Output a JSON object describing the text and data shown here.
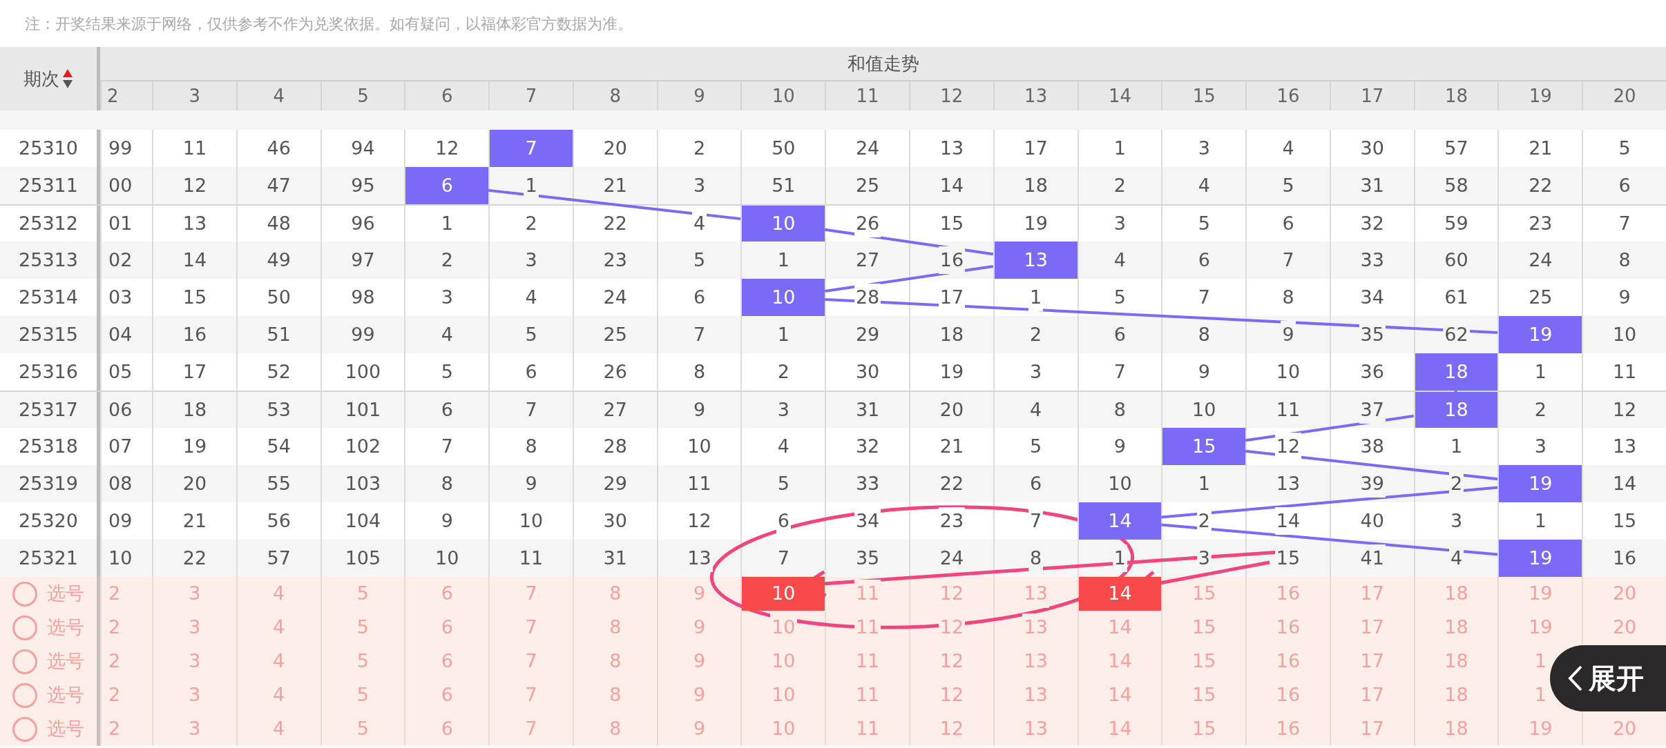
{
  "notice": "注：开奖结果来源于网络，仅供参考不作为兑奖依据。如有疑问，以福体彩官方数据为准。",
  "table": {
    "period_header": "期次",
    "sort_ascending": true,
    "group_header": "和值走势",
    "columns": [
      "2",
      "3",
      "4",
      "5",
      "6",
      "7",
      "8",
      "9",
      "10",
      "11",
      "12",
      "13",
      "14",
      "15",
      "16",
      "17",
      "18",
      "19",
      "20"
    ],
    "rows": [
      {
        "period": "25310",
        "cells": [
          "99",
          "11",
          "46",
          "94",
          "12",
          {
            "text": "7",
            "hit": true
          },
          "20",
          "2",
          "50",
          "24",
          "13",
          "17",
          "1",
          "3",
          "4",
          "30",
          "57",
          "21",
          "5"
        ]
      },
      {
        "period": "25311",
        "cells": [
          "00",
          "12",
          "47",
          "95",
          {
            "text": "6",
            "hit": true
          },
          "1",
          "21",
          "3",
          "51",
          "25",
          "14",
          "18",
          "2",
          "4",
          "5",
          "31",
          "58",
          "22",
          "6"
        ]
      },
      {
        "period": "25312",
        "cells": [
          "01",
          "13",
          "48",
          "96",
          "1",
          "2",
          "22",
          "4",
          {
            "text": "10",
            "hit": true
          },
          "26",
          "15",
          "19",
          "3",
          "5",
          "6",
          "32",
          "59",
          "23",
          "7"
        ]
      },
      {
        "period": "25313",
        "cells": [
          "02",
          "14",
          "49",
          "97",
          "2",
          "3",
          "23",
          "5",
          "1",
          "27",
          "16",
          {
            "text": "13",
            "hit": true
          },
          "4",
          "6",
          "7",
          "33",
          "60",
          "24",
          "8"
        ]
      },
      {
        "period": "25314",
        "cells": [
          "03",
          "15",
          "50",
          "98",
          "3",
          "4",
          "24",
          "6",
          {
            "text": "10",
            "hit": true
          },
          "28",
          "17",
          "1",
          "5",
          "7",
          "8",
          "34",
          "61",
          "25",
          "9"
        ]
      },
      {
        "period": "25315",
        "cells": [
          "04",
          "16",
          "51",
          "99",
          "4",
          "5",
          "25",
          "7",
          "1",
          "29",
          "18",
          "2",
          "6",
          "8",
          "9",
          "35",
          "62",
          {
            "text": "19",
            "hit": true
          },
          "10"
        ]
      },
      {
        "period": "25316",
        "cells": [
          "05",
          "17",
          "52",
          "100",
          "5",
          "6",
          "26",
          "8",
          "2",
          "30",
          "19",
          "3",
          "7",
          "9",
          "10",
          "36",
          {
            "text": "18",
            "hit": true
          },
          "1",
          "11"
        ]
      },
      {
        "period": "25317",
        "cells": [
          "06",
          "18",
          "53",
          "101",
          "6",
          "7",
          "27",
          "9",
          "3",
          "31",
          "20",
          "4",
          "8",
          "10",
          "11",
          "37",
          {
            "text": "18",
            "hit": true
          },
          "2",
          "12"
        ]
      },
      {
        "period": "25318",
        "cells": [
          "07",
          "19",
          "54",
          "102",
          "7",
          "8",
          "28",
          "10",
          "4",
          "32",
          "21",
          "5",
          "9",
          {
            "text": "15",
            "hit": true
          },
          "12",
          "38",
          "1",
          "3",
          "13"
        ]
      },
      {
        "period": "25319",
        "cells": [
          "08",
          "20",
          "55",
          "103",
          "8",
          "9",
          "29",
          "11",
          "5",
          "33",
          "22",
          "6",
          "10",
          "1",
          "13",
          "39",
          "2",
          {
            "text": "19",
            "hit": true
          },
          "14"
        ]
      },
      {
        "period": "25320",
        "cells": [
          "09",
          "21",
          "56",
          "104",
          "9",
          "10",
          "30",
          "12",
          "6",
          "34",
          "23",
          "7",
          {
            "text": "14",
            "hit": true
          },
          "2",
          "14",
          "40",
          "3",
          "1",
          "15"
        ]
      },
      {
        "period": "25321",
        "cells": [
          "10",
          "22",
          "57",
          "105",
          "10",
          "11",
          "31",
          "13",
          "7",
          "35",
          "24",
          "8",
          "1",
          "3",
          "15",
          "41",
          "4",
          {
            "text": "19",
            "hit": true
          },
          "16"
        ]
      }
    ],
    "pick_rows": [
      {
        "label": "选号",
        "checked": false,
        "cells": [
          {
            "text": "2",
            "selected": false
          },
          {
            "text": "3",
            "selected": false
          },
          {
            "text": "4",
            "selected": false
          },
          {
            "text": "5",
            "selected": false
          },
          {
            "text": "6",
            "selected": false
          },
          {
            "text": "7",
            "selected": false
          },
          {
            "text": "8",
            "selected": false
          },
          {
            "text": "9",
            "selected": false
          },
          {
            "text": "10",
            "selected": true
          },
          {
            "text": "11",
            "selected": false
          },
          {
            "text": "12",
            "selected": false
          },
          {
            "text": "13",
            "selected": false
          },
          {
            "text": "14",
            "selected": true
          },
          {
            "text": "15",
            "selected": false
          },
          {
            "text": "16",
            "selected": false
          },
          {
            "text": "17",
            "selected": false
          },
          {
            "text": "18",
            "selected": false
          },
          {
            "text": "19",
            "selected": false
          },
          {
            "text": "20",
            "selected": false
          }
        ]
      },
      {
        "label": "选号",
        "checked": false,
        "cells": [
          {
            "text": "2",
            "selected": false
          },
          {
            "text": "3",
            "selected": false
          },
          {
            "text": "4",
            "selected": false
          },
          {
            "text": "5",
            "selected": false
          },
          {
            "text": "6",
            "selected": false
          },
          {
            "text": "7",
            "selected": false
          },
          {
            "text": "8",
            "selected": false
          },
          {
            "text": "9",
            "selected": false
          },
          {
            "text": "10",
            "selected": false
          },
          {
            "text": "11",
            "selected": false
          },
          {
            "text": "12",
            "selected": false
          },
          {
            "text": "13",
            "selected": false
          },
          {
            "text": "14",
            "selected": false
          },
          {
            "text": "15",
            "selected": false
          },
          {
            "text": "16",
            "selected": false
          },
          {
            "text": "17",
            "selected": false
          },
          {
            "text": "18",
            "selected": false
          },
          {
            "text": "19",
            "selected": false
          },
          {
            "text": "20",
            "selected": false
          }
        ]
      },
      {
        "label": "选号",
        "checked": false,
        "cells": [
          {
            "text": "2",
            "selected": false
          },
          {
            "text": "3",
            "selected": false
          },
          {
            "text": "4",
            "selected": false
          },
          {
            "text": "5",
            "selected": false
          },
          {
            "text": "6",
            "selected": false
          },
          {
            "text": "7",
            "selected": false
          },
          {
            "text": "8",
            "selected": false
          },
          {
            "text": "9",
            "selected": false
          },
          {
            "text": "10",
            "selected": false
          },
          {
            "text": "11",
            "selected": false
          },
          {
            "text": "12",
            "selected": false
          },
          {
            "text": "13",
            "selected": false
          },
          {
            "text": "14",
            "selected": false
          },
          {
            "text": "15",
            "selected": false
          },
          {
            "text": "16",
            "selected": false
          },
          {
            "text": "17",
            "selected": false
          },
          {
            "text": "18",
            "selected": false
          },
          {
            "text": "1",
            "selected": false
          }
        ]
      },
      {
        "label": "选号",
        "checked": false,
        "cells": [
          {
            "text": "2",
            "selected": false
          },
          {
            "text": "3",
            "selected": false
          },
          {
            "text": "4",
            "selected": false
          },
          {
            "text": "5",
            "selected": false
          },
          {
            "text": "6",
            "selected": false
          },
          {
            "text": "7",
            "selected": false
          },
          {
            "text": "8",
            "selected": false
          },
          {
            "text": "9",
            "selected": false
          },
          {
            "text": "10",
            "selected": false
          },
          {
            "text": "11",
            "selected": false
          },
          {
            "text": "12",
            "selected": false
          },
          {
            "text": "13",
            "selected": false
          },
          {
            "text": "14",
            "selected": false
          },
          {
            "text": "15",
            "selected": false
          },
          {
            "text": "16",
            "selected": false
          },
          {
            "text": "17",
            "selected": false
          },
          {
            "text": "18",
            "selected": false
          },
          {
            "text": "1",
            "selected": false
          }
        ]
      },
      {
        "label": "选号",
        "checked": false,
        "cells": [
          {
            "text": "2",
            "selected": false
          },
          {
            "text": "3",
            "selected": false
          },
          {
            "text": "4",
            "selected": false
          },
          {
            "text": "5",
            "selected": false
          },
          {
            "text": "6",
            "selected": false
          },
          {
            "text": "7",
            "selected": false
          },
          {
            "text": "8",
            "selected": false
          },
          {
            "text": "9",
            "selected": false
          },
          {
            "text": "10",
            "selected": false
          },
          {
            "text": "11",
            "selected": false
          },
          {
            "text": "12",
            "selected": false
          },
          {
            "text": "13",
            "selected": false
          },
          {
            "text": "14",
            "selected": false
          },
          {
            "text": "15",
            "selected": false
          },
          {
            "text": "16",
            "selected": false
          },
          {
            "text": "17",
            "selected": false
          },
          {
            "text": "18",
            "selected": false
          },
          {
            "text": "19",
            "selected": false
          },
          {
            "text": "20",
            "selected": false
          }
        ]
      }
    ]
  },
  "expand_button": {
    "label": "展开"
  },
  "annotations": [
    {
      "kind": "ellipse"
    },
    {
      "kind": "arrow"
    },
    {
      "kind": "arrow"
    }
  ]
}
